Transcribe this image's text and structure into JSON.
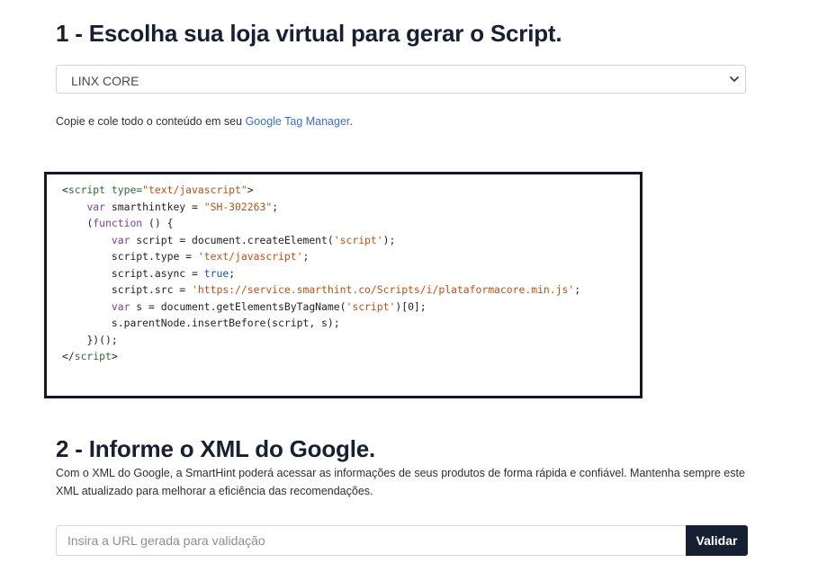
{
  "section1": {
    "title": "1 - Escolha sua loja virtual para gerar o Script.",
    "platform_select": {
      "selected": "LINX CORE"
    },
    "instruction_prefix": "Copie e cole todo o conteúdo em seu ",
    "instruction_link": "Google Tag Manager",
    "instruction_suffix": "."
  },
  "code": {
    "open_tag_start": "<",
    "open_tag_name": "script",
    "open_attr": " type=",
    "open_attr_value": "\"text/javascript\"",
    "open_tag_end": ">",
    "line2_indent": "    ",
    "line2_kw": "var",
    "line2_mid": " smarthintkey = ",
    "line2_value": "\"SH-302263\"",
    "line2_end": ";",
    "line3_indent": "    ",
    "line3_open": "(",
    "line3_kw": "function",
    "line3_rest": " () {",
    "line4_indent": "        ",
    "line4_kw": "var",
    "line4_mid": " script = document.createElement(",
    "line4_str": "'script'",
    "line4_end": ");",
    "line5_indent": "        ",
    "line5_mid": "script.type = ",
    "line5_str": "'text/javascript'",
    "line5_end": ";",
    "line6_indent": "        ",
    "line6_mid": "script.async = ",
    "line6_bool": "true",
    "line6_end": ";",
    "line7_indent": "        ",
    "line7_mid": "script.src = ",
    "line7_str": "'https://service.smarthint.co/Scripts/i/plataformacore.min.js'",
    "line7_end": ";",
    "line8_indent": "        ",
    "line8_kw": "var",
    "line8_mid": " s = document.getElementsByTagName(",
    "line8_str": "'script'",
    "line8_end": ")[0];",
    "line9_indent": "        ",
    "line9_text": "s.parentNode.insertBefore(script, s);",
    "line10_indent": "    ",
    "line10_text": "})();",
    "close_start": "</",
    "close_name": "script",
    "close_end": ">"
  },
  "section2": {
    "title": "2 - Informe o XML do Google.",
    "description": "Com o XML do Google, a SmartHint poderá acessar as informações de seus produtos de forma rápida e confiável. Mantenha sempre este XML atualizado para melhorar a eficiência das recomendações.",
    "url_input": {
      "value": "",
      "placeholder": "Insira a URL gerada para validação"
    },
    "validate_label": "Validar"
  },
  "icons": {
    "select_chevron": "chevron-down-icon"
  },
  "colors": {
    "heading": "#172033",
    "link": "#3a72b8",
    "code_border": "#121631",
    "button_bg": "#172033",
    "button_text": "#ffffff"
  }
}
